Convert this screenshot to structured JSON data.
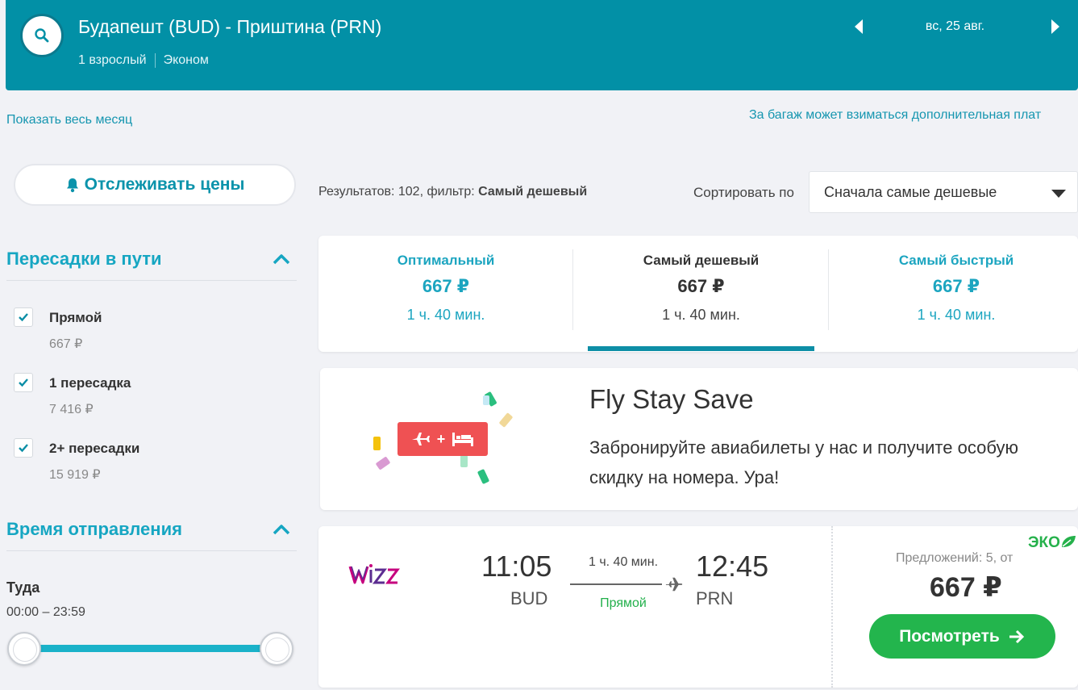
{
  "header": {
    "route": "Будапешт (BUD) - Приштина (PRN)",
    "passengers": "1 взрослый",
    "cabin_class": "Эконом",
    "date": "вс, 25 авг.",
    "icons": {
      "search": "search-icon",
      "prev": "caret-left-icon",
      "next": "caret-right-icon"
    }
  },
  "links": {
    "show_month": "Показать весь месяц",
    "baggage_note": "За багаж может взиматься дополнительная плат"
  },
  "track_prices": {
    "label": "Отслеживать цены",
    "icon": "bell-icon"
  },
  "filters": {
    "stops": {
      "title": "Пересадки в пути",
      "options": [
        {
          "label": "Прямой",
          "price": "667 ₽",
          "checked": true
        },
        {
          "label": "1 пересадка",
          "price": "7 416 ₽",
          "checked": true
        },
        {
          "label": "2+ пересадки",
          "price": "15 919 ₽",
          "checked": true
        }
      ]
    },
    "departure_time": {
      "title": "Время отправления",
      "direction": "Туда",
      "range": "00:00 – 23:59"
    }
  },
  "results": {
    "count_prefix": "Результатов: 102, фильтр:",
    "filter_name": "Самый дешевый"
  },
  "sort": {
    "label": "Сортировать по",
    "selected": "Сначала самые дешевые"
  },
  "tabs": [
    {
      "title": "Оптимальный",
      "price": "667 ₽",
      "duration": "1 ч. 40 мин."
    },
    {
      "title": "Самый дешевый",
      "price": "667 ₽",
      "duration": "1 ч. 40 мин.",
      "active": true
    },
    {
      "title": "Самый быстрый",
      "price": "667 ₽",
      "duration": "1 ч. 40 мин."
    }
  ],
  "promo": {
    "title": "Fly Stay Save",
    "text": "Забронируйте авиабилеты у нас и получите особую скидку на номера. Ура!",
    "badge_plus": "+"
  },
  "flight": {
    "airline": "Wizz Air",
    "depart_time": "11:05",
    "depart_code": "BUD",
    "duration": "1 ч. 40 мин.",
    "stops": "Прямой",
    "arrive_time": "12:45",
    "arrive_code": "PRN",
    "eco": "ЭКО",
    "offers": "Предложений: 5, от",
    "price": "667 ₽",
    "view_label": "Посмотреть"
  },
  "colors": {
    "header_bg": "#0290a6",
    "accent_teal": "#16a6c2",
    "green": "#23b54d",
    "promo_red": "#ef5153"
  }
}
